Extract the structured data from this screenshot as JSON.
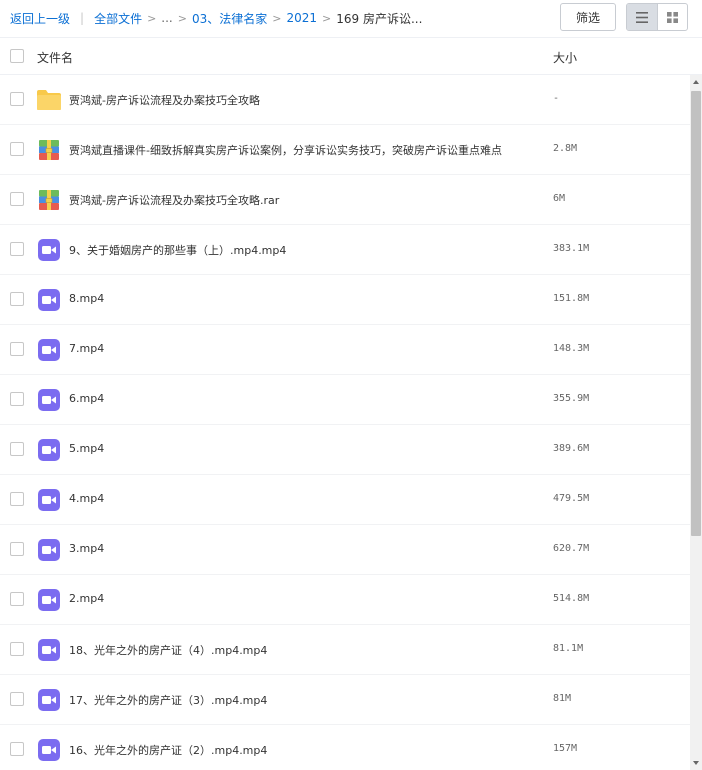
{
  "breadcrumb": {
    "back": "返回上一级",
    "all_files": "全部文件",
    "ellipsis": "...",
    "path": [
      "03、法律名家",
      "2021"
    ],
    "current": "169 房产诉讼..."
  },
  "toolbar": {
    "filter_label": "筛选"
  },
  "columns": {
    "name": "文件名",
    "size": "大小"
  },
  "files": [
    {
      "type": "folder",
      "name": "贾鸿斌-房产诉讼流程及办案技巧全攻略",
      "size": "-"
    },
    {
      "type": "archive",
      "name": "贾鸿斌直播课件-细致拆解真实房产诉讼案例，分享诉讼实务技巧，突破房产诉讼重点难点",
      "size": "2.8M"
    },
    {
      "type": "archive",
      "name": "贾鸿斌-房产诉讼流程及办案技巧全攻略.rar",
      "size": "6M"
    },
    {
      "type": "video",
      "name": "9、关于婚姻房产的那些事（上）.mp4.mp4",
      "size": "383.1M"
    },
    {
      "type": "video",
      "name": "8.mp4",
      "size": "151.8M"
    },
    {
      "type": "video",
      "name": "7.mp4",
      "size": "148.3M"
    },
    {
      "type": "video",
      "name": "6.mp4",
      "size": "355.9M"
    },
    {
      "type": "video",
      "name": "5.mp4",
      "size": "389.6M"
    },
    {
      "type": "video",
      "name": "4.mp4",
      "size": "479.5M"
    },
    {
      "type": "video",
      "name": "3.mp4",
      "size": "620.7M"
    },
    {
      "type": "video",
      "name": "2.mp4",
      "size": "514.8M"
    },
    {
      "type": "video",
      "name": "18、光年之外的房产证（4）.mp4.mp4",
      "size": "81.1M"
    },
    {
      "type": "video",
      "name": "17、光年之外的房产证（3）.mp4.mp4",
      "size": "81M"
    },
    {
      "type": "video",
      "name": "16、光年之外的房产证（2）.mp4.mp4",
      "size": "157M"
    }
  ],
  "colors": {
    "link": "#0b6fd4",
    "folder": "#f8c94a",
    "video": "#7b6cf0"
  }
}
